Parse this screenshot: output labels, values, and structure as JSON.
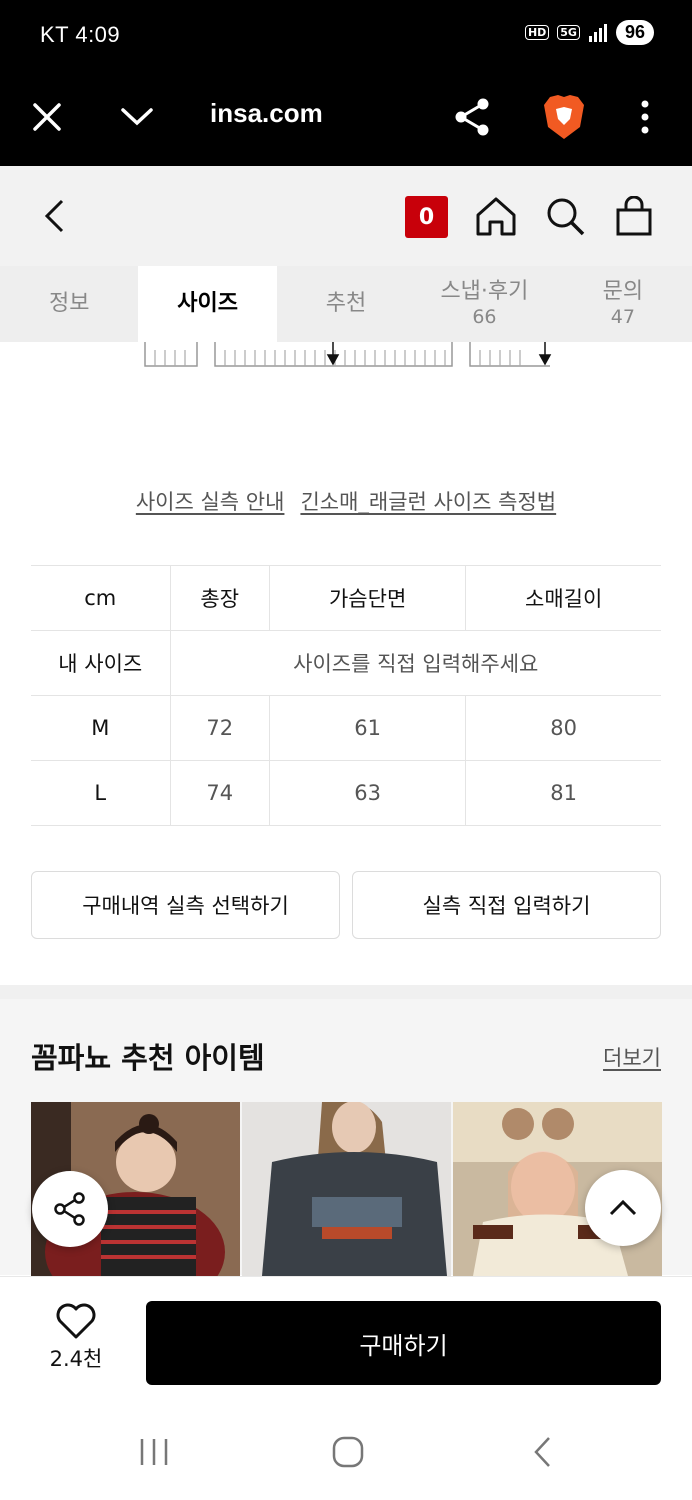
{
  "status_bar": {
    "carrier_time": "KT 4:09",
    "network": "5G",
    "hd": "HD",
    "battery": "96"
  },
  "browser": {
    "url": "insa.com"
  },
  "header": {
    "cart_count": "0"
  },
  "tabs": [
    {
      "label": "정보",
      "count": ""
    },
    {
      "label": "사이즈",
      "count": ""
    },
    {
      "label": "추천",
      "count": ""
    },
    {
      "label": "스냅·후기",
      "count": "66"
    },
    {
      "label": "문의",
      "count": "47"
    }
  ],
  "guides": {
    "size_guide": "사이즈 실측 안내",
    "measure_guide": "긴소매_래글런 사이즈 측정법"
  },
  "size_table": {
    "headers": [
      "cm",
      "총장",
      "가슴단면",
      "소매길이"
    ],
    "my_size_label": "내 사이즈",
    "my_size_placeholder": "사이즈를 직접 입력해주세요",
    "rows": [
      {
        "size": "M",
        "values": [
          "72",
          "61",
          "80"
        ]
      },
      {
        "size": "L",
        "values": [
          "74",
          "63",
          "81"
        ]
      }
    ]
  },
  "actions": {
    "history_button": "구매내역 실측 선택하기",
    "direct_button": "실측 직접 입력하기"
  },
  "recommend": {
    "title": "꼼파뇨 추천 아이템",
    "more": "더보기"
  },
  "bottom": {
    "like_count": "2.4천",
    "buy_label": "구매하기"
  }
}
